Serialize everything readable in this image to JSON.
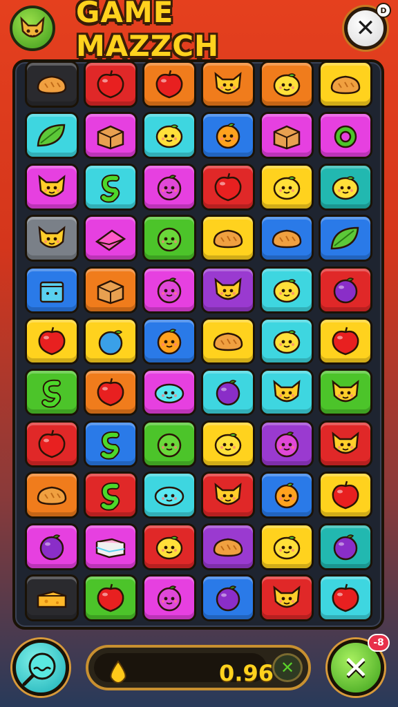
{
  "header": {
    "title": "GAME MAZZCH",
    "avatar_icon": "fox-face-icon",
    "close_icon": "close-icon",
    "close_symbol": "✕",
    "corner_badge": "D"
  },
  "colors": {
    "black": "#2a2a2e",
    "red": "#e02828",
    "orange": "#f07c1c",
    "yellow": "#ffd21e",
    "cyan": "#3ed6e0",
    "blue": "#2a7ae8",
    "magenta": "#e640e0",
    "purple": "#9a3ad0",
    "green": "#4cc42a",
    "teal": "#22b8b0",
    "gray": "#7a8088",
    "pink": "#ff5aa8"
  },
  "board": {
    "rows": [
      [
        {
          "bg": "black",
          "icon": "bread"
        },
        {
          "bg": "red",
          "icon": "apple"
        },
        {
          "bg": "orange",
          "icon": "apple"
        },
        {
          "bg": "orange",
          "icon": "fox"
        },
        {
          "bg": "orange",
          "icon": "lemon"
        },
        {
          "bg": "yellow",
          "icon": "bread"
        }
      ],
      [
        {
          "bg": "cyan",
          "icon": "leaf"
        },
        {
          "bg": "magenta",
          "icon": "box"
        },
        {
          "bg": "cyan",
          "icon": "lemon"
        },
        {
          "bg": "blue",
          "icon": "orange"
        },
        {
          "bg": "magenta",
          "icon": "box"
        },
        {
          "bg": "magenta",
          "icon": "ring"
        }
      ],
      [
        {
          "bg": "magenta",
          "icon": "fox"
        },
        {
          "bg": "cyan",
          "icon": "snake"
        },
        {
          "bg": "magenta",
          "icon": "plum"
        },
        {
          "bg": "red",
          "icon": "apple"
        },
        {
          "bg": "yellow",
          "icon": "lemon"
        },
        {
          "bg": "teal",
          "icon": "lemon"
        }
      ],
      [
        {
          "bg": "gray",
          "icon": "fox"
        },
        {
          "bg": "magenta",
          "icon": "wedge"
        },
        {
          "bg": "green",
          "icon": "lime"
        },
        {
          "bg": "yellow",
          "icon": "bread"
        },
        {
          "bg": "blue",
          "icon": "bread"
        },
        {
          "bg": "blue",
          "icon": "leaf"
        }
      ],
      [
        {
          "bg": "blue",
          "icon": "cube"
        },
        {
          "bg": "orange",
          "icon": "box"
        },
        {
          "bg": "magenta",
          "icon": "plum"
        },
        {
          "bg": "purple",
          "icon": "fox"
        },
        {
          "bg": "cyan",
          "icon": "lemon"
        },
        {
          "bg": "red",
          "icon": "grape"
        }
      ],
      [
        {
          "bg": "yellow",
          "icon": "apple"
        },
        {
          "bg": "yellow",
          "icon": "blueberry"
        },
        {
          "bg": "blue",
          "icon": "orange"
        },
        {
          "bg": "yellow",
          "icon": "bread"
        },
        {
          "bg": "cyan",
          "icon": "lemon"
        },
        {
          "bg": "yellow",
          "icon": "apple"
        }
      ],
      [
        {
          "bg": "green",
          "icon": "snake"
        },
        {
          "bg": "orange",
          "icon": "apple"
        },
        {
          "bg": "magenta",
          "icon": "fish"
        },
        {
          "bg": "cyan",
          "icon": "grape"
        },
        {
          "bg": "cyan",
          "icon": "fox"
        },
        {
          "bg": "green",
          "icon": "fox"
        }
      ],
      [
        {
          "bg": "red",
          "icon": "apple"
        },
        {
          "bg": "blue",
          "icon": "snake"
        },
        {
          "bg": "green",
          "icon": "lime"
        },
        {
          "bg": "yellow",
          "icon": "lemon"
        },
        {
          "bg": "purple",
          "icon": "plum"
        },
        {
          "bg": "red",
          "icon": "fox"
        }
      ],
      [
        {
          "bg": "orange",
          "icon": "bread"
        },
        {
          "bg": "red",
          "icon": "snake"
        },
        {
          "bg": "cyan",
          "icon": "fish"
        },
        {
          "bg": "red",
          "icon": "fox"
        },
        {
          "bg": "blue",
          "icon": "orange"
        },
        {
          "bg": "yellow",
          "icon": "apple"
        }
      ],
      [
        {
          "bg": "magenta",
          "icon": "grape"
        },
        {
          "bg": "magenta",
          "icon": "book"
        },
        {
          "bg": "red",
          "icon": "lemon"
        },
        {
          "bg": "purple",
          "icon": "bread"
        },
        {
          "bg": "yellow",
          "icon": "lemon"
        },
        {
          "bg": "teal",
          "icon": "grape"
        }
      ],
      [
        {
          "bg": "black",
          "icon": "cheese"
        },
        {
          "bg": "green",
          "icon": "apple"
        },
        {
          "bg": "magenta",
          "icon": "plum"
        },
        {
          "bg": "blue",
          "icon": "grape"
        },
        {
          "bg": "red",
          "icon": "fox"
        },
        {
          "bg": "cyan",
          "icon": "apple"
        }
      ]
    ]
  },
  "footer": {
    "left_icon": "magnifier-icon",
    "drop_icon": "droplet-icon",
    "score": "0.96",
    "bar_close_symbol": "✕",
    "right_icon": "close-icon",
    "right_symbol": "✕",
    "notification": "-8"
  }
}
